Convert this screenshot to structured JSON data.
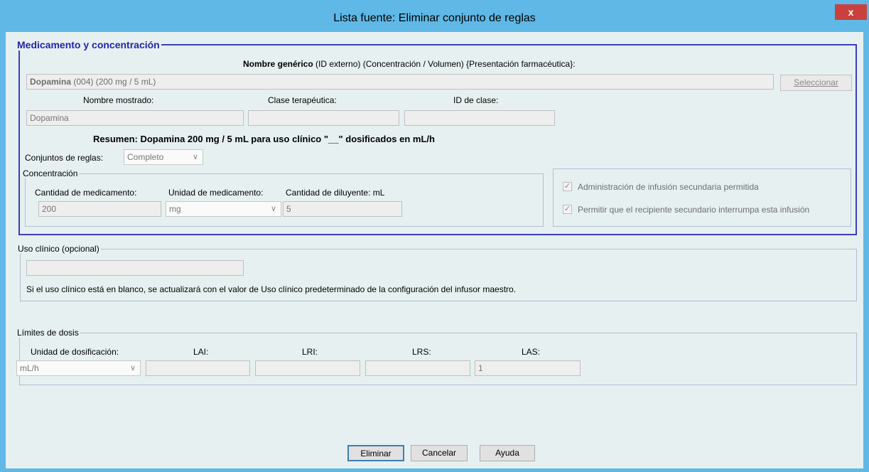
{
  "window": {
    "title": "Lista fuente: Eliminar conjunto de reglas",
    "close_label": "x"
  },
  "med": {
    "legend": "Medicamento y concentración",
    "header_bold": "Nombre genérico",
    "header_rest": "(ID externo) (Concentración / Volumen) {Presentación farmacéutica}:",
    "drug_name": "Dopamina",
    "drug_details": "(004) (200 mg / 5 mL)",
    "select_label": "Seleccionar",
    "display_name_label": "Nombre mostrado:",
    "display_name_value": "Dopamina",
    "therapeutic_class_label": "Clase terapéutica:",
    "therapeutic_class_value": "",
    "class_id_label": "ID de clase:",
    "class_id_value": "",
    "summary": "Resumen: Dopamina 200 mg / 5 mL para uso clínico \"__\" dosificados en mL/h",
    "rule_sets_label": "Conjuntos de reglas:",
    "rule_sets_value": "Completo"
  },
  "concentration": {
    "legend": "Concentración",
    "amount_label": "Cantidad de medicamento:",
    "amount_value": "200",
    "unit_label": "Unidad de medicamento:",
    "unit_value": "mg",
    "diluent_label": "Cantidad de diluyente: mL",
    "diluent_value": "5"
  },
  "secondary": {
    "allow_secondary_label": "Administración de infusión secundaria permitida",
    "allow_secondary_checked": true,
    "allow_interrupt_label": "Permitir que el recipiente secundario interrumpa esta infusión",
    "allow_interrupt_checked": true
  },
  "clinical_use": {
    "legend": "Uso clínico (opcional)",
    "value": "",
    "note": "Si el uso clínico está en blanco, se actualizará con el valor de Uso clínico predeterminado de la configuración del infusor maestro."
  },
  "dose_limits": {
    "legend": "Límites de dosis",
    "dosing_unit_label": "Unidad de dosificación:",
    "dosing_unit_value": "mL/h",
    "lai_label": "LAI:",
    "lai_value": "",
    "lri_label": "LRI:",
    "lri_value": "",
    "lrs_label": "LRS:",
    "lrs_value": "",
    "las_label": "LAS:",
    "las_value": "1"
  },
  "buttons": {
    "delete_label": "Eliminar",
    "cancel_label": "Cancelar",
    "help_label": "Ayuda"
  }
}
